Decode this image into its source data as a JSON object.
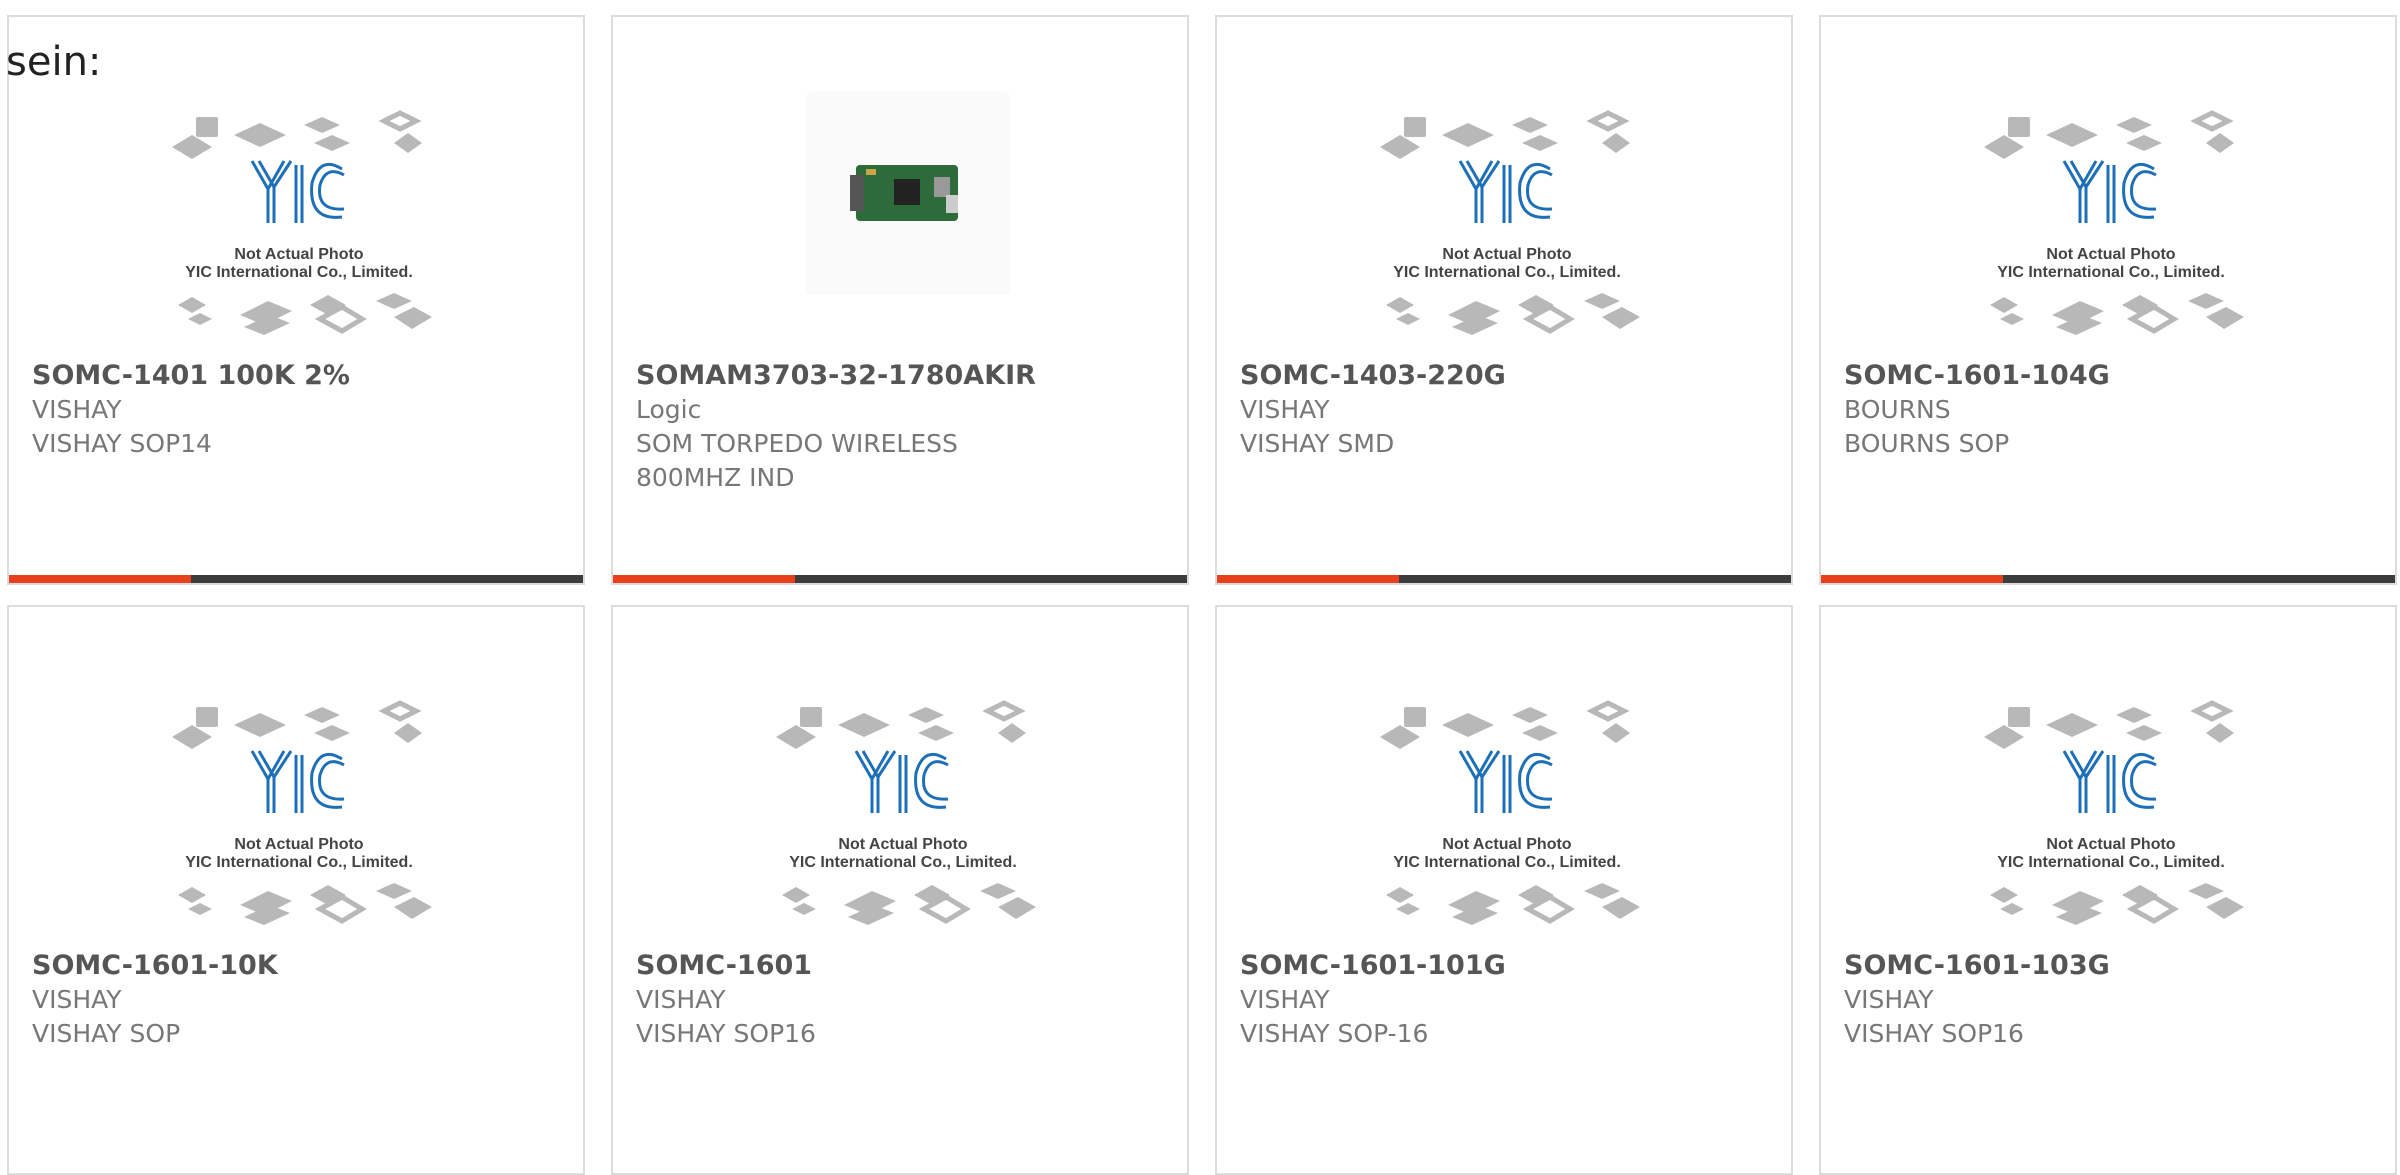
{
  "page": {
    "lead_text": "sein:"
  },
  "placeholder": {
    "line1": "Not Actual Photo",
    "line2": "YIC International Co., Limited."
  },
  "colors": {
    "accent": "#e8401c",
    "bar": "#3c3c3c",
    "logo": "#1d6fb8",
    "chip": "#b8b8b8",
    "border": "#dcdcdc"
  },
  "products": [
    {
      "part": "SOMC-1401 100K 2%",
      "maker": "VISHAY",
      "desc": "VISHAY SOP14",
      "image": "placeholder-logo"
    },
    {
      "part": "SOMAM3703-32-1780AKIR",
      "maker": "Logic",
      "desc": "SOM TORPEDO WIRELESS 800MHZ IND",
      "image": "board-photo"
    },
    {
      "part": "SOMC-1403-220G",
      "maker": "VISHAY",
      "desc": "VISHAY SMD",
      "image": "placeholder-logo"
    },
    {
      "part": "SOMC-1601-104G",
      "maker": "BOURNS",
      "desc": "BOURNS SOP",
      "image": "placeholder-logo"
    },
    {
      "part": "SOMC-1601-10K",
      "maker": "VISHAY",
      "desc": "VISHAY SOP",
      "image": "placeholder-logo"
    },
    {
      "part": "SOMC-1601",
      "maker": "VISHAY",
      "desc": "VISHAY SOP16",
      "image": "placeholder-logo"
    },
    {
      "part": "SOMC-1601-101G",
      "maker": "VISHAY",
      "desc": "VISHAY SOP-16",
      "image": "placeholder-logo"
    },
    {
      "part": "SOMC-1601-103G",
      "maker": "VISHAY",
      "desc": "VISHAY SOP16",
      "image": "placeholder-logo"
    }
  ]
}
